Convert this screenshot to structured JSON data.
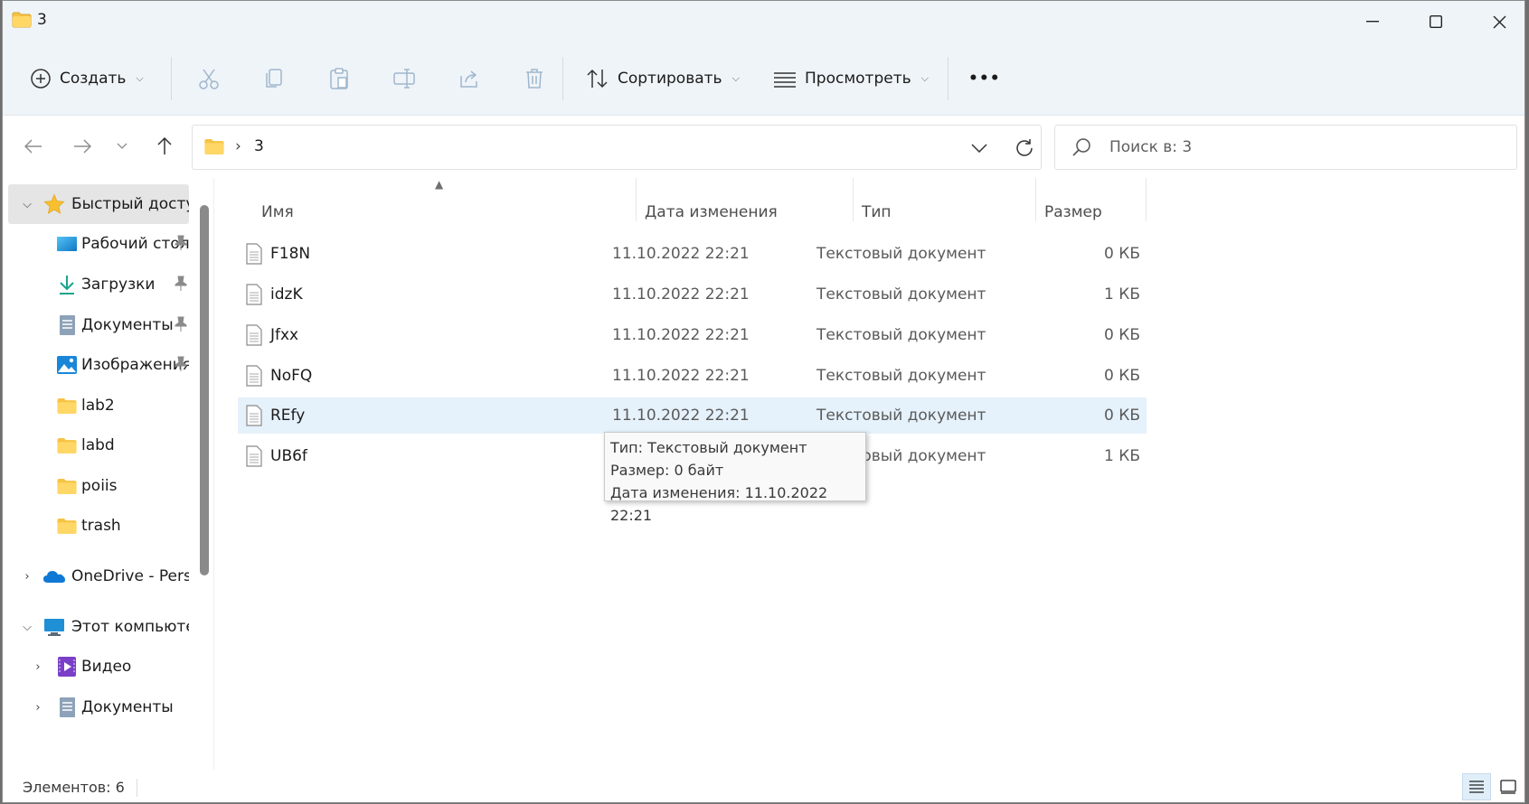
{
  "window": {
    "title": "3"
  },
  "commandbar": {
    "new_label": "Создать",
    "sort_label": "Сортировать",
    "view_label": "Просмотреть",
    "more_label": "•••"
  },
  "address": {
    "separator": "›",
    "path": "3"
  },
  "search": {
    "placeholder": "Поиск в: 3"
  },
  "sidebar": {
    "items": [
      {
        "label": "Быстрый доступ",
        "icon": "star-icon",
        "expanded": true
      },
      {
        "label": "Рабочий стол",
        "icon": "desktop-icon",
        "pinned": true
      },
      {
        "label": "Загрузки",
        "icon": "download-icon",
        "pinned": true
      },
      {
        "label": "Документы",
        "icon": "documents-icon",
        "pinned": true
      },
      {
        "label": "Изображения",
        "icon": "pictures-icon",
        "pinned": true
      },
      {
        "label": "lab2",
        "icon": "folder-icon"
      },
      {
        "label": "labd",
        "icon": "folder-icon"
      },
      {
        "label": "poiis",
        "icon": "folder-icon"
      },
      {
        "label": "trash",
        "icon": "folder-icon"
      },
      {
        "label": "OneDrive - Personal",
        "icon": "onedrive-icon",
        "expanded": false
      },
      {
        "label": "Этот компьютер",
        "icon": "computer-icon",
        "expanded": true
      },
      {
        "label": "Видео",
        "icon": "video-icon",
        "expanded": false
      },
      {
        "label": "Документы",
        "icon": "documents-icon",
        "expanded": false
      }
    ]
  },
  "columns": {
    "name": "Имя",
    "date": "Дата изменения",
    "type": "Тип",
    "size": "Размер"
  },
  "files": [
    {
      "name": "F18N",
      "date": "11.10.2022 22:21",
      "type": "Текстовый документ",
      "size": "0 КБ"
    },
    {
      "name": "idzK",
      "date": "11.10.2022 22:21",
      "type": "Текстовый документ",
      "size": "1 КБ"
    },
    {
      "name": "Jfxx",
      "date": "11.10.2022 22:21",
      "type": "Текстовый документ",
      "size": "0 КБ"
    },
    {
      "name": "NoFQ",
      "date": "11.10.2022 22:21",
      "type": "Текстовый документ",
      "size": "0 КБ"
    },
    {
      "name": "REfy",
      "date": "11.10.2022 22:21",
      "type": "Текстовый документ",
      "size": "0 КБ"
    },
    {
      "name": "UB6f",
      "date": "",
      "type": "Текстовый документ",
      "size": "1 КБ"
    }
  ],
  "tooltip": {
    "line1": "Тип: Текстовый документ",
    "line2": "Размер: 0 байт",
    "line3": "Дата изменения: 11.10.2022 22:21"
  },
  "status": {
    "items_count": "Элементов: 6"
  },
  "colors": {
    "accent": "#0078d4",
    "folder": "#f6c343",
    "hover_row": "#e5f1fb",
    "selected_nav": "#e5e5e5"
  }
}
